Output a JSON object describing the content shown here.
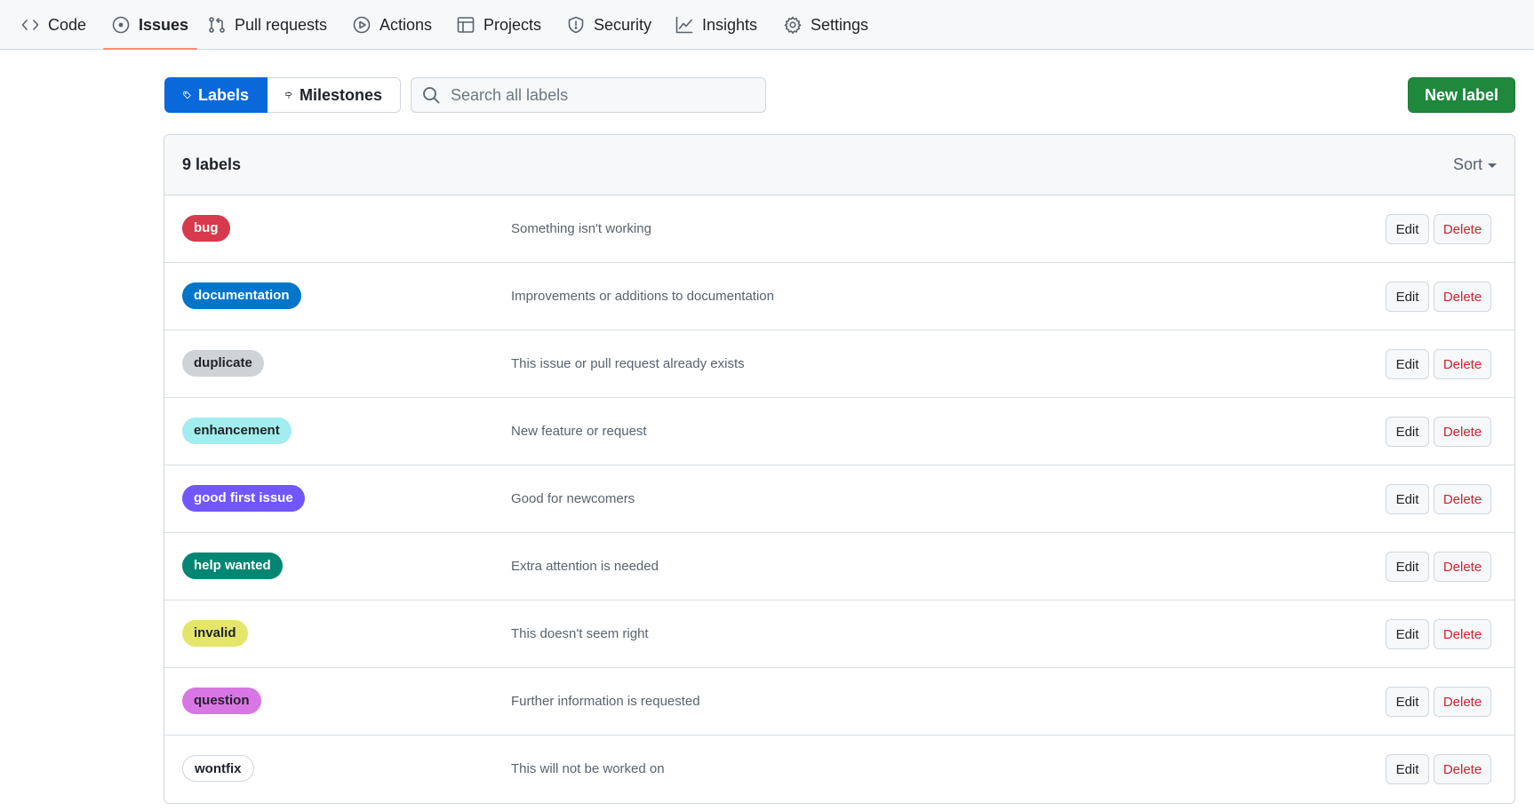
{
  "repo_nav": {
    "items": [
      {
        "label": "Code",
        "icon": "code-icon"
      },
      {
        "label": "Issues",
        "icon": "issue-opened-icon",
        "active": true
      },
      {
        "label": "Pull requests",
        "icon": "git-pull-request-icon"
      },
      {
        "label": "Actions",
        "icon": "play-icon"
      },
      {
        "label": "Projects",
        "icon": "table-icon"
      },
      {
        "label": "Security",
        "icon": "shield-icon"
      },
      {
        "label": "Insights",
        "icon": "graph-icon"
      },
      {
        "label": "Settings",
        "icon": "gear-icon"
      }
    ]
  },
  "subnav": {
    "labels_tab": "Labels",
    "milestones_tab": "Milestones",
    "search_placeholder": "Search all labels",
    "new_label": "New label"
  },
  "labels_box": {
    "count": "9 labels",
    "sort": "Sort",
    "edit_label": "Edit",
    "delete_label": "Delete",
    "labels": [
      {
        "name": "bug",
        "description": "Something isn't working",
        "color": "#d73a4a",
        "text_color": "#ffffff"
      },
      {
        "name": "documentation",
        "description": "Improvements or additions to documentation",
        "color": "#0075ca",
        "text_color": "#ffffff"
      },
      {
        "name": "duplicate",
        "description": "This issue or pull request already exists",
        "color": "#cfd3d7",
        "text_color": "#1f2328"
      },
      {
        "name": "enhancement",
        "description": "New feature or request",
        "color": "#a2eeef",
        "text_color": "#1f2328"
      },
      {
        "name": "good first issue",
        "description": "Good for newcomers",
        "color": "#7057ff",
        "text_color": "#ffffff"
      },
      {
        "name": "help wanted",
        "description": "Extra attention is needed",
        "color": "#008672",
        "text_color": "#ffffff"
      },
      {
        "name": "invalid",
        "description": "This doesn't seem right",
        "color": "#e4e669",
        "text_color": "#1f2328"
      },
      {
        "name": "question",
        "description": "Further information is requested",
        "color": "#d876e3",
        "text_color": "#1f2328"
      },
      {
        "name": "wontfix",
        "description": "This will not be worked on",
        "color": "#ffffff",
        "text_color": "#1f2328"
      }
    ]
  }
}
